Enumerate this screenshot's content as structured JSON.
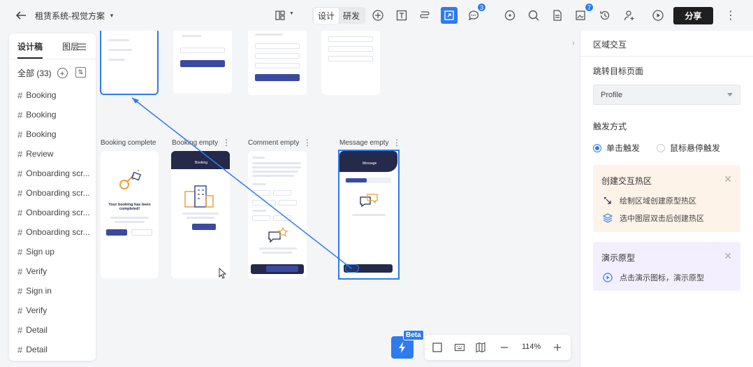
{
  "topbar": {
    "project_title": "租赁系统-视觉方案",
    "mode_design": "设计",
    "mode_dev": "研发",
    "comments_badge": "3",
    "versions_badge": "7",
    "share_label": "分享"
  },
  "left_panel": {
    "tab_design": "设计稿",
    "tab_layers": "图层",
    "all_label": "全部 (33)",
    "pages": [
      "Booking",
      "Booking",
      "Booking",
      "Review",
      "Onboarding scr...",
      "Onboarding scr...",
      "Onboarding scr...",
      "Onboarding scr...",
      "Sign up",
      "Verify",
      "Sign in",
      "Verify",
      "Detail",
      "Detail"
    ]
  },
  "canvas": {
    "frames": [
      {
        "label": "Booking complete"
      },
      {
        "label": "Booking empty"
      },
      {
        "label": "Comment empty"
      },
      {
        "label": "Message empty"
      }
    ],
    "booking_complete_text": "Your booking has been completed!",
    "booking_header": "Booking",
    "message_header": "Message"
  },
  "bottom_toolbar": {
    "beta_label": "Beta",
    "zoom": "114%"
  },
  "right_panel": {
    "section_title": "区域交互",
    "target_label": "跳转目标页面",
    "target_value": "Profile",
    "trigger_label": "触发方式",
    "trigger_click": "单击触发",
    "trigger_hover": "鼠标悬停触发",
    "hotspot_card": {
      "title": "创建交互热区",
      "row1": "绘制区域创建原型热区",
      "row2": "选中图层双击后创建热区"
    },
    "demo_card": {
      "title": "演示原型",
      "row1": "点击演示图标，演示原型"
    }
  }
}
